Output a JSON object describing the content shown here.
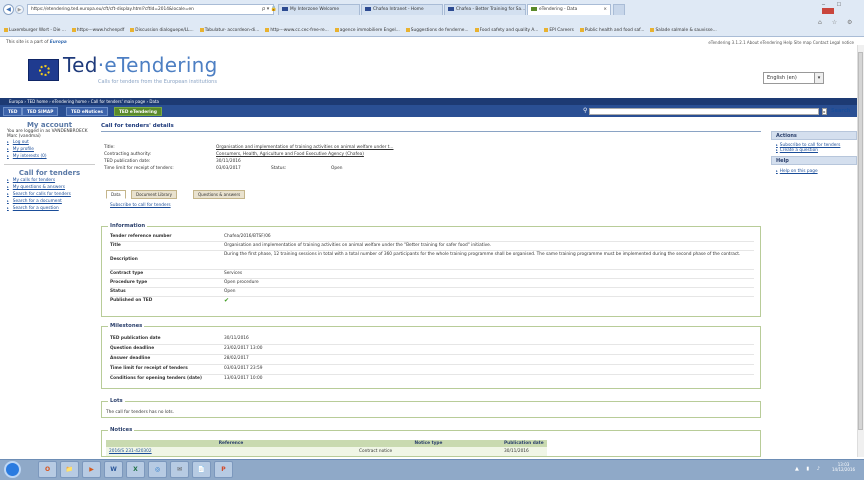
{
  "browser": {
    "address": "https://etendering.ted.europa.eu/cft/cft-display.html?cftId=2014&locale=en",
    "address_tools": "ρ ▾ 🔒 C",
    "tabs": [
      {
        "label": "My Interzone Welcome",
        "active": false
      },
      {
        "label": "Chafea Intranet - Home",
        "active": false
      },
      {
        "label": "Chafea - Better Training for Sa...",
        "active": false
      },
      {
        "label": "eTendering - Data",
        "active": true
      }
    ],
    "tab_close": "×",
    "favorites": [
      "Luxemburger Wort - Die ...",
      "https---www.hchenpdf",
      "Discussion dialoguepe/LL...",
      "Tabulatur- accordeon-di...",
      "http---www.cc.cec-free-re...",
      "agence immobiliere Engel...",
      "Suggestions de fenderne...",
      "Food safety and quality A...",
      "EPI Careers",
      "Public health and food saf...",
      "Salade salmale & sauvisse..."
    ]
  },
  "site": {
    "part_of_text": "This site is a part of",
    "part_of_brand": "Europa",
    "top_links": "eTendering 3.1.2.1  About eTendering  Help  Site map  Contact  Legal notice",
    "brand_ted": "Ted",
    "brand_dash": "·",
    "brand_etendering": "eTendering",
    "tagline": "Calls for tenders from the European institutions",
    "language": "English (en)",
    "language_btn": "▾"
  },
  "nav": {
    "breadcrumb": "Europa › TED home › eTendering home › Call for tenders' main page › Data",
    "tabs": [
      "TED",
      "TED SIMAP",
      "TED eNotices",
      "TED eTendering"
    ],
    "search_placeholder": "",
    "search_btn_icon": "▸",
    "search_label": "Search"
  },
  "sidebar": {
    "account_title": "My account",
    "logged_in_text": "You are logged in as VANDENBROECK Marc (vandmai)",
    "account_links": [
      "Log out",
      "My profile",
      "My interests (0)"
    ],
    "tenders_title": "Call for tenders",
    "tenders_links": [
      "My calls for tenders",
      "My questions & answers",
      "Search for calls for tenders",
      "Search for a document",
      "Search for a question"
    ]
  },
  "main": {
    "title": "Call for tenders' details",
    "title_label": "Title:",
    "title_value": "Organisation and implementation of training activities on animal welfare under t...",
    "authority_label": "Contracting authority:",
    "authority_value": "Consumers, Health, Agriculture and Food Executive Agency (Chafea)",
    "pub_label": "TED publication date:",
    "pub_value": "30/11/2016",
    "deadline_label": "Time limit for receipt of tenders:",
    "deadline_value": "03/03/2017",
    "status_label": "Status:",
    "status_value": "Open",
    "page_tabs": [
      "Data",
      "Document Library",
      "Questions & answers"
    ],
    "subscribe_link": "Subscribe to call for tenders"
  },
  "information": {
    "legend": "Information",
    "rows": [
      {
        "label": "Tender reference number",
        "value": "Chafea/2016/BTSF/06"
      },
      {
        "label": "Title",
        "value": "Organisation and implementation of training activities on animal welfare under the \"Better training for safer food\" initiative."
      },
      {
        "label": "Description",
        "value": "During the first phase, 12 training sessions in total with a total number of 360 participants for the whole training programme shall be organised. The same training programme must be implemented during the second phase of the contract."
      },
      {
        "label": "Contract type",
        "value": "Services"
      },
      {
        "label": "Procedure type",
        "value": "Open procedure"
      },
      {
        "label": "Status",
        "value": "Open"
      },
      {
        "label": "Published on TED",
        "value": "✔"
      }
    ]
  },
  "milestones": {
    "legend": "Milestones",
    "rows": [
      {
        "label": "TED publication date",
        "value": "30/11/2016"
      },
      {
        "label": "Question deadline",
        "value": "23/02/2017 13:00"
      },
      {
        "label": "Answer deadline",
        "value": "28/02/2017"
      },
      {
        "label": "Time limit for receipt of tenders",
        "value": "03/03/2017 23:59"
      },
      {
        "label": "Conditions for opening tenders (date)",
        "value": "13/03/2017 10:00"
      }
    ]
  },
  "lots": {
    "legend": "Lots",
    "text": "The call for tenders has no lots."
  },
  "notices": {
    "legend": "Notices",
    "headers": [
      "Reference",
      "Notice type",
      "Publication date"
    ],
    "rows": [
      {
        "reference": "2016/S 231-420302",
        "type": "Contract notice",
        "date": "30/11/2016"
      }
    ]
  },
  "actions": {
    "title": "Actions",
    "links": [
      "Subscribe to call for tenders",
      "Create a question"
    ],
    "help_title": "Help",
    "help_links": [
      "Help on this page"
    ]
  },
  "taskbar": {
    "apps": [
      "O",
      "📁",
      "▶",
      "W",
      "X",
      "◎",
      "✉",
      "📄",
      "P"
    ],
    "clock": "13:03",
    "date": "14/12/2016"
  }
}
